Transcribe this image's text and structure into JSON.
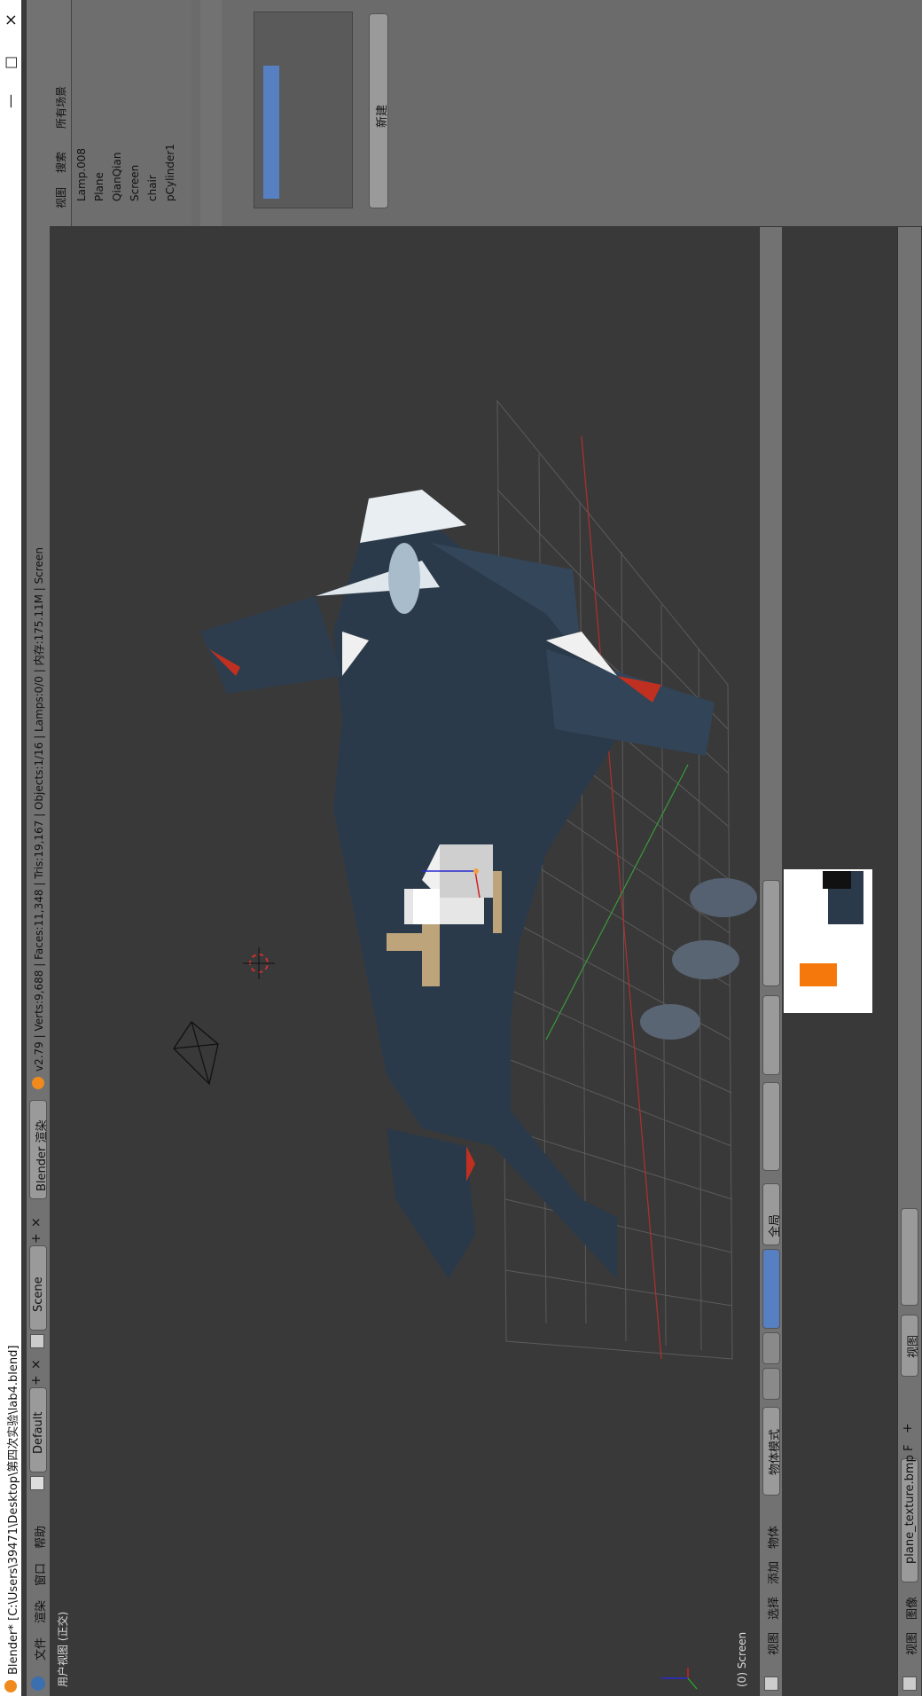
{
  "window": {
    "title": "Blender* [C:\\Users\\39471\\Desktop\\第四次实验\\lab4.blend]",
    "controls": [
      "×",
      "□",
      "—"
    ]
  },
  "menubar": {
    "items": [
      "文件",
      "渲染",
      "窗口",
      "帮助"
    ],
    "layout": "Default",
    "scene": "Scene",
    "engine": "Blender 渲染",
    "stats": "v2.79 | Verts:9,688 | Faces:11,348 | Tris:19,167 | Objects:1/16 | Lamps:0/0 | 内存:175.11M | Screen"
  },
  "viewport": {
    "view_label": "用户视图 (正交)",
    "object_label": "(0) Screen"
  },
  "viewport_header": {
    "menus": [
      "视图",
      "选择",
      "添加",
      "物体"
    ],
    "mode": "物体模式",
    "pivot": "全局"
  },
  "outliner": {
    "tabs": [
      "视图",
      "搜索",
      "所有场景"
    ],
    "items": [
      "Lamp.008",
      "Plane",
      "QianQian",
      "Screen",
      "chair",
      "pCylinder1"
    ]
  },
  "properties": {
    "new_button": "新建"
  },
  "image_editor": {
    "menus": [
      "视图",
      "图像"
    ],
    "image_name": "plane_texture.bmp",
    "fake_user": "F",
    "view_label": "视图"
  },
  "colors": {
    "background": "#393939",
    "header": "#727272",
    "accent": "#5680c2",
    "orange": "#f4780c"
  }
}
